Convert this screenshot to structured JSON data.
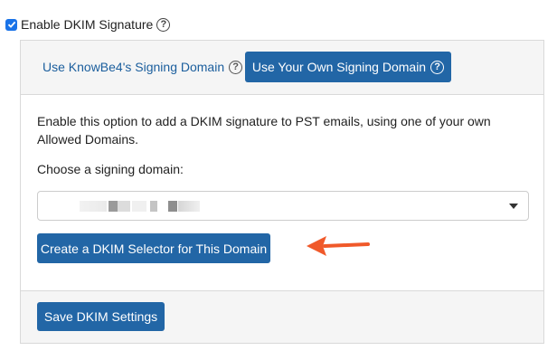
{
  "dkim": {
    "enable_label": "Enable DKIM Signature",
    "enabled": true
  },
  "tabs": [
    {
      "label": "Use KnowBe4's Signing Domain",
      "active": false
    },
    {
      "label": "Use Your Own Signing Domain",
      "active": true
    }
  ],
  "content": {
    "description": "Enable this option to add a DKIM signature to PST emails, using one of your own Allowed Domains.",
    "choose_label": "Choose a signing domain:",
    "create_button": "Create a DKIM Selector for This Domain"
  },
  "footer": {
    "save_button": "Save DKIM Settings"
  },
  "colors": {
    "primary": "#2266a6",
    "link": "#1b5e9d",
    "checkbox": "#1a73e8",
    "arrow": "#f0592a"
  }
}
